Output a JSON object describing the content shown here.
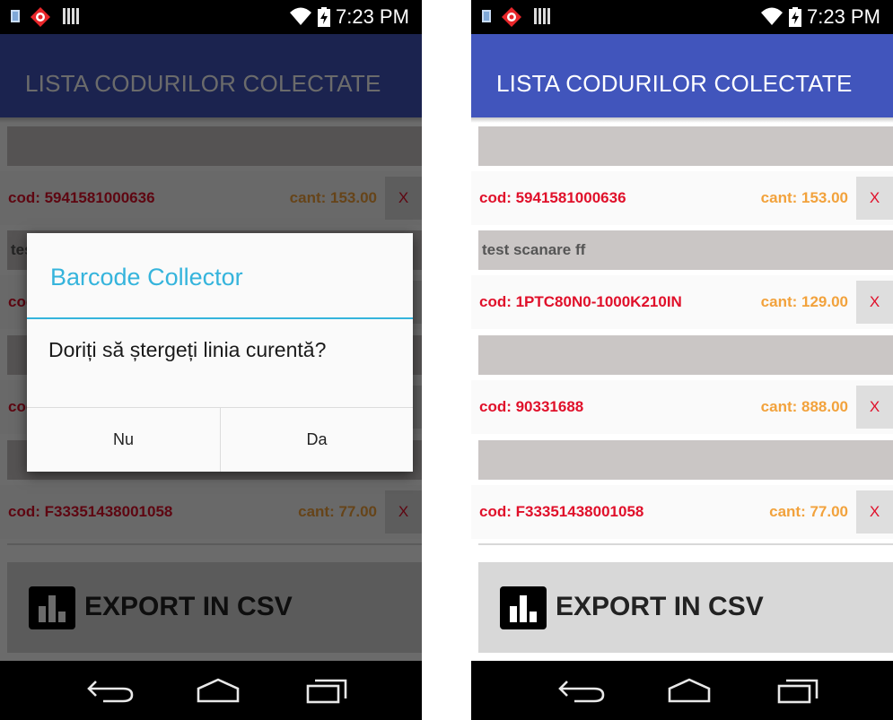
{
  "status_bar": {
    "time": "7:23 PM"
  },
  "app": {
    "title": "LISTA CODURILOR COLECTATE"
  },
  "items": [
    {
      "note": "",
      "code": "cod: 5941581000636",
      "qty": "cant: 153.00",
      "delete_label": "X"
    },
    {
      "note": "test scanare ff",
      "code": "cod: 1PTC80N0-1000K210IN",
      "qty": "cant: 129.00",
      "delete_label": "X"
    },
    {
      "note": "",
      "code": "cod: 90331688",
      "qty": "cant: 888.00",
      "delete_label": "X"
    },
    {
      "note": "",
      "code": "cod: F33351438001058",
      "qty": "cant: 77.00",
      "delete_label": "X"
    }
  ],
  "export_button": {
    "label": "EXPORT IN CSV",
    "icon": "bar-chart-icon"
  },
  "dialog": {
    "title": "Barcode Collector",
    "message": "Doriți să ștergeți linia curentă?",
    "no_label": "Nu",
    "yes_label": "Da"
  },
  "nav": {
    "back": "back-icon",
    "home": "home-icon",
    "recent": "recent-apps-icon"
  },
  "colors": {
    "app_bar": "#4155bc",
    "code_text": "#e0102a",
    "qty_text": "#f2a23c",
    "dialog_accent": "#35b4dc",
    "note_background": "#cac6c5",
    "export_background": "#d8d8d8"
  }
}
